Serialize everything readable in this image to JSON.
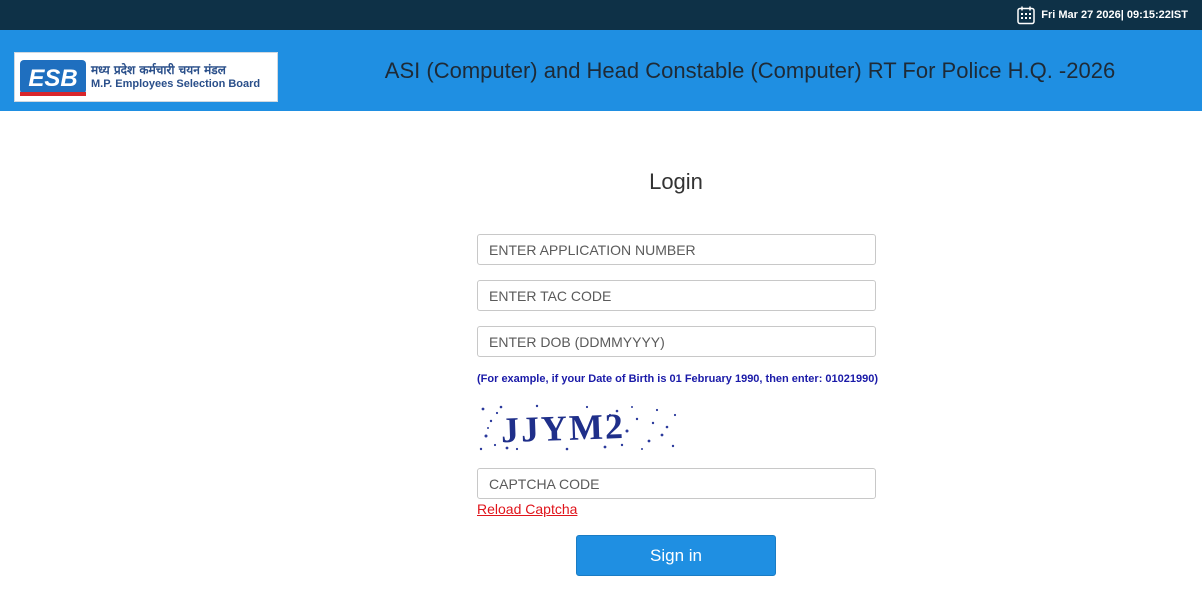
{
  "topbar": {
    "datetime": "Fri Mar 27 2026| 09:15:22IST",
    "icon": "calendar-icon"
  },
  "header": {
    "logo_abbr": "ESB",
    "logo_hindi": "मध्य प्रदेश कर्मचारी चयन मंडल",
    "logo_english": "M.P. Employees Selection Board",
    "title": "ASI (Computer) and Head Constable (Computer) RT For Police H.Q. -2026",
    "background": "#1f8fe2"
  },
  "login": {
    "title": "Login",
    "application_placeholder": "ENTER APPLICATION NUMBER",
    "tac_placeholder": "ENTER TAC CODE",
    "dob_placeholder": "ENTER DOB (DDMMYYYY)",
    "dob_hint": "(For example, if your Date of Birth is 01 February 1990, then enter: 01021990)",
    "captcha_text": "JJYM2",
    "captcha_placeholder": "CAPTCHA CODE",
    "reload_label": "Reload Captcha",
    "signin_label": "Sign in"
  },
  "colors": {
    "topbar": "#0e3147",
    "accent": "#1f8fe2",
    "hint": "#1a1aa8",
    "link": "#e0141b"
  }
}
